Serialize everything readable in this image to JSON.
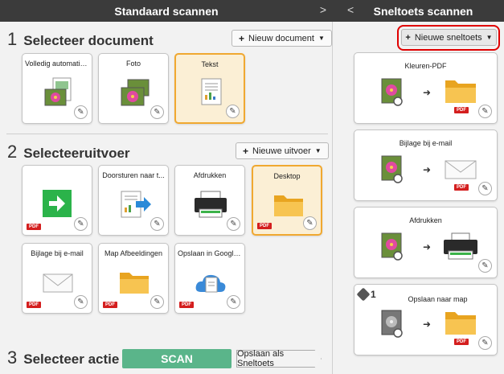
{
  "left_header": {
    "title": "Standaard scannen",
    "arrow": ">"
  },
  "right_header": {
    "title": "Sneltoets scannen",
    "arrow": "<"
  },
  "section1": {
    "number": "1",
    "title": "Selecteer document",
    "new_button": "Nieuw document",
    "cards": [
      {
        "label": "Volledig automatis...",
        "icon": "photo-document-icon",
        "selected": false
      },
      {
        "label": "Foto",
        "icon": "photo-icon",
        "selected": false
      },
      {
        "label": "Tekst",
        "icon": "text-document-icon",
        "selected": true
      }
    ]
  },
  "section2": {
    "number": "2",
    "title": "Selecteeruitvoer",
    "new_button": "Nieuwe uitvoer",
    "cards": [
      {
        "label": "",
        "icon": "green-arrow-icon",
        "pdf": "PDF",
        "selected": false
      },
      {
        "label": "Doorsturen naar t...",
        "icon": "forward-document-icon",
        "pdf": "",
        "selected": false
      },
      {
        "label": "Afdrukken",
        "icon": "printer-icon",
        "pdf": "",
        "selected": false
      },
      {
        "label": "Desktop",
        "icon": "folder-icon",
        "pdf": "PDF",
        "selected": true
      },
      {
        "label": "Bijlage bij e-mail",
        "icon": "envelope-icon",
        "pdf": "PDF",
        "selected": false
      },
      {
        "label": "Map Afbeeldingen",
        "icon": "folder-icon",
        "pdf": "PDF",
        "selected": false
      },
      {
        "label": "Opslaan in Google...",
        "icon": "cloud-icon",
        "pdf": "PDF",
        "selected": false
      }
    ]
  },
  "section3": {
    "number": "3",
    "title": "Selecteer actie",
    "scan_button": "SCAN",
    "save_button": "Opslaan als Sneltoets"
  },
  "shortcuts": {
    "new_button": "Nieuwe sneltoets",
    "items": [
      {
        "label": "Kleuren-PDF",
        "dest": "folder-icon",
        "pdf": "PDF",
        "badge": ""
      },
      {
        "label": "Bijlage bij e-mail",
        "dest": "envelope-icon",
        "pdf": "PDF",
        "badge": ""
      },
      {
        "label": "Afdrukken",
        "dest": "printer-icon",
        "pdf": "",
        "badge": ""
      },
      {
        "label": "Opslaan naar map",
        "dest": "folder-icon",
        "pdf": "PDF",
        "badge": "1"
      }
    ]
  },
  "colors": {
    "accent_orange": "#f0a830",
    "scan_green": "#5ab58a",
    "header": "#3b3b3b",
    "highlight_red": "#e00000",
    "pdf_red": "#d41e1e"
  }
}
